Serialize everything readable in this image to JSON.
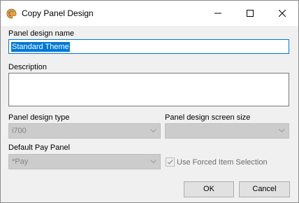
{
  "window": {
    "title": "Copy Panel Design",
    "icon": "palette-icon"
  },
  "form": {
    "name_label": "Panel design name",
    "name_value": "Standard Theme",
    "description_label": "Description",
    "description_value": "",
    "type_label": "Panel design type",
    "type_value": "i700",
    "screen_size_label": "Panel design screen size",
    "screen_size_value": "",
    "pay_panel_label": "Default Pay Panel",
    "pay_panel_value": "*Pay",
    "forced_item_label": "Use Forced Item Selection",
    "forced_item_checked": true
  },
  "buttons": {
    "ok": "OK",
    "cancel": "Cancel"
  },
  "colors": {
    "accent": "#0078d7",
    "dialog_bg": "#f0f0f0",
    "disabled_bg": "#cccccc"
  }
}
